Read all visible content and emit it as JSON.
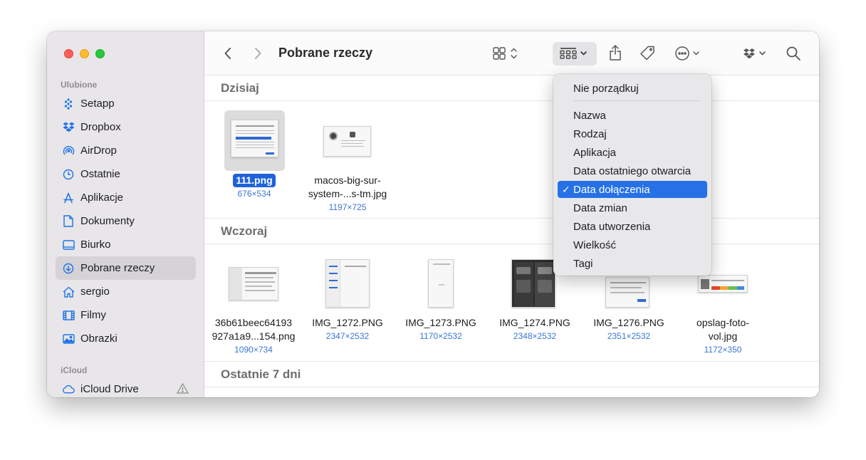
{
  "window": {
    "title": "Pobrane rzeczy"
  },
  "sidebar": {
    "favorites_label": "Ulubione",
    "items": [
      {
        "label": "Setapp",
        "icon": "setapp-icon"
      },
      {
        "label": "Dropbox",
        "icon": "dropbox-icon"
      },
      {
        "label": "AirDrop",
        "icon": "airdrop-icon"
      },
      {
        "label": "Ostatnie",
        "icon": "clock-icon"
      },
      {
        "label": "Aplikacje",
        "icon": "applications-icon"
      },
      {
        "label": "Dokumenty",
        "icon": "document-icon"
      },
      {
        "label": "Biurko",
        "icon": "desktop-icon"
      },
      {
        "label": "Pobrane rzeczy",
        "icon": "downloads-icon",
        "selected": true
      },
      {
        "label": "sergio",
        "icon": "home-icon"
      },
      {
        "label": "Filmy",
        "icon": "film-icon"
      },
      {
        "label": "Obrazki",
        "icon": "photo-icon"
      }
    ],
    "icloud_label": "iCloud",
    "icloud_items": [
      {
        "label": "iCloud Drive",
        "icon": "cloud-icon"
      }
    ]
  },
  "groups": [
    {
      "title": "Dzisiaj",
      "files": [
        {
          "name": "111.png",
          "dims": "676×534",
          "selected": true
        },
        {
          "name_line1": "macos-big-sur-",
          "name_line2": "system-...s-tm.jpg",
          "dims": "1197×725"
        }
      ]
    },
    {
      "title": "Wczoraj",
      "files": [
        {
          "name_line1": "36b61beec64193",
          "name_line2": "927a1a9...154.png",
          "dims": "1090×734"
        },
        {
          "name": "IMG_1272.PNG",
          "dims": "2347×2532"
        },
        {
          "name": "IMG_1273.PNG",
          "dims": "1170×2532"
        },
        {
          "name": "IMG_1274.PNG",
          "dims": "2348×2532"
        },
        {
          "name": "IMG_1276.PNG",
          "dims": "2351×2532"
        },
        {
          "name_line1": "opslag-foto-",
          "name_line2": "vol.jpg",
          "dims": "1172×350"
        }
      ]
    },
    {
      "title": "Ostatnie 7 dni",
      "files": []
    }
  ],
  "sort_menu": {
    "items": [
      {
        "label": "Nie porządkuj"
      },
      {
        "label": "Nazwa"
      },
      {
        "label": "Rodzaj"
      },
      {
        "label": "Aplikacja"
      },
      {
        "label": "Data ostatniego otwarcia"
      },
      {
        "label": "Data dołączenia",
        "checked": true
      },
      {
        "label": "Data zmian"
      },
      {
        "label": "Data utworzenia"
      },
      {
        "label": "Wielkość"
      },
      {
        "label": "Tagi"
      }
    ],
    "check_glyph": "✓"
  },
  "colors": {
    "accent": "#2671e5",
    "sidebar_bg": "#e8e6e8",
    "icon_blue": "#1e73e8"
  }
}
